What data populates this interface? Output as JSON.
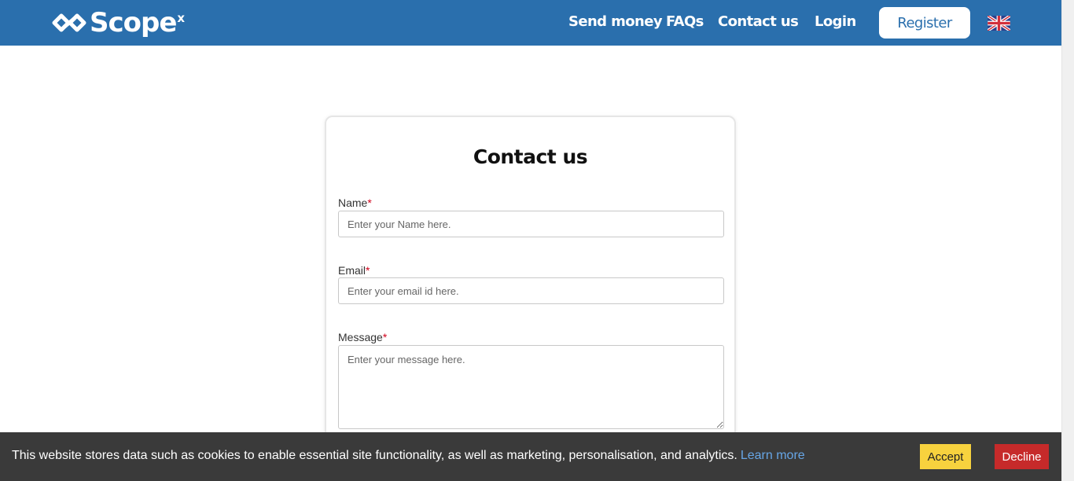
{
  "header": {
    "logo_text": "Scope",
    "logo_suffix": "x",
    "nav": {
      "send_money": "Send money",
      "faqs": "FAQs",
      "contact_us": "Contact us",
      "login": "Login",
      "register": "Register"
    },
    "language_icon": "uk-flag-icon",
    "background_color": "#2a6fad"
  },
  "contact_form": {
    "title": "Contact us",
    "required_marker": "*",
    "name": {
      "label": "Name",
      "placeholder": "Enter your Name here.",
      "value": ""
    },
    "email": {
      "label": "Email",
      "placeholder": "Enter your email id here.",
      "value": ""
    },
    "message": {
      "label": "Message",
      "placeholder": "Enter your message here.",
      "value": ""
    }
  },
  "cookie_banner": {
    "text": "This website stores data such as cookies to enable essential site functionality, as well as marketing, personalisation, and analytics.",
    "learn_more": "Learn more",
    "accept": "Accept",
    "decline": "Decline",
    "accept_color": "#f7d23e",
    "decline_color": "#c62a2a"
  }
}
